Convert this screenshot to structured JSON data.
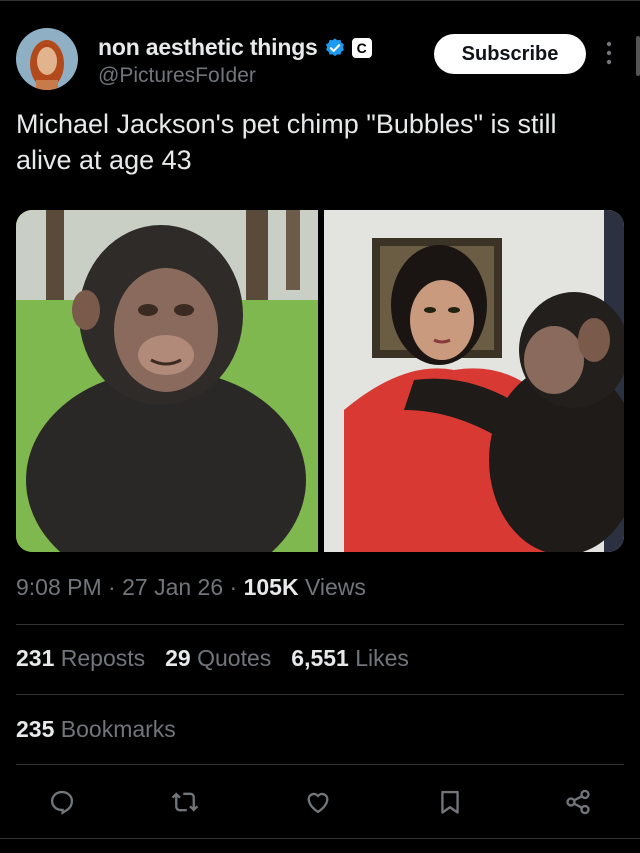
{
  "user": {
    "display_name": "non aesthetic things",
    "handle": "@PicturesFoIder",
    "affiliate_badge": "C",
    "subscribe_label": "Subscribe"
  },
  "tweet": {
    "text": "Michael Jackson's pet chimp \"Bubbles\" is still alive at age 43"
  },
  "meta": {
    "time": "9:08 PM",
    "date": "27 Jan 26",
    "views_count": "105K",
    "views_label": "Views"
  },
  "stats": {
    "reposts_count": "231",
    "reposts_label": "Reposts",
    "quotes_count": "29",
    "quotes_label": "Quotes",
    "likes_count": "6,551",
    "likes_label": "Likes",
    "bookmarks_count": "235",
    "bookmarks_label": "Bookmarks"
  },
  "actions": [
    "reply-icon",
    "repost-icon",
    "like-icon",
    "bookmark-icon",
    "share-icon"
  ],
  "colors": {
    "verified": "#1d9bf0",
    "muted": "#71767b",
    "text": "#e7e9ea",
    "divider": "#2f3336"
  }
}
